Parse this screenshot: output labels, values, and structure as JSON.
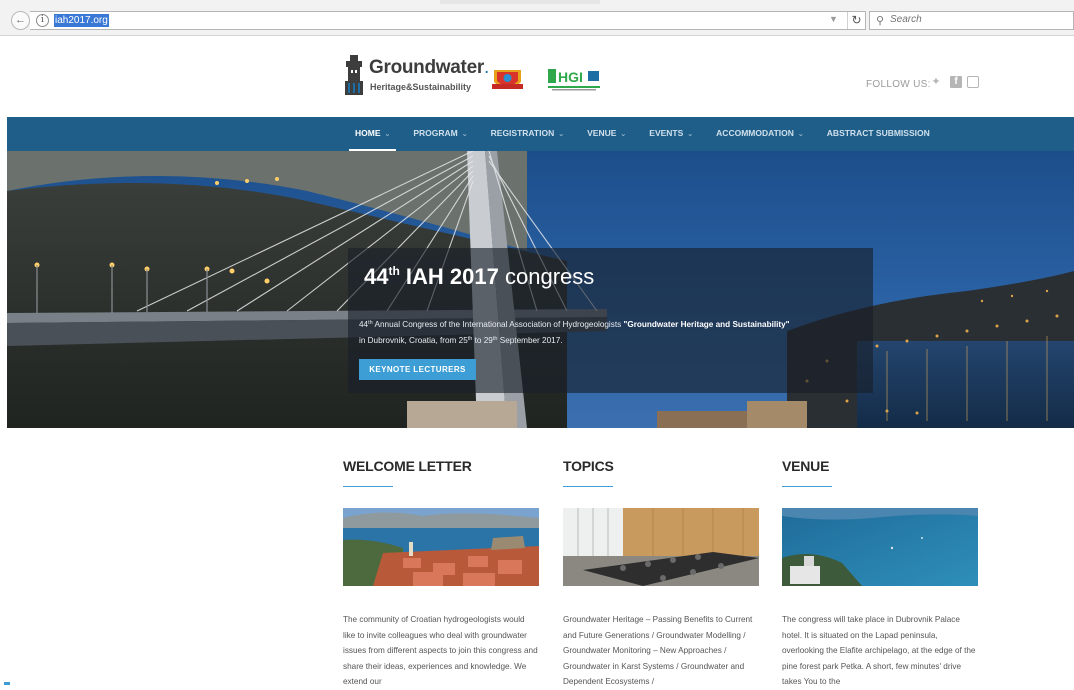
{
  "browser": {
    "url": "iah2017.org",
    "search_placeholder": "Search"
  },
  "header": {
    "logo_title_main": "Groundwater",
    "logo_title_accent": ".",
    "logo_subtitle": "Heritage&Sustainability",
    "partner_logo_text": "HGI",
    "follow_us": "FOLLOW US:"
  },
  "nav": {
    "items": [
      {
        "label": "HOME",
        "has_caret": true
      },
      {
        "label": "PROGRAM",
        "has_caret": true
      },
      {
        "label": "REGISTRATION",
        "has_caret": true
      },
      {
        "label": "VENUE",
        "has_caret": true
      },
      {
        "label": "EVENTS",
        "has_caret": true
      },
      {
        "label": "ACCOMMODATION",
        "has_caret": true
      },
      {
        "label": "ABSTRACT SUBMISSION",
        "has_caret": false
      }
    ],
    "caret": "⌄"
  },
  "hero": {
    "title_ordinal": "44",
    "title_sup": "th",
    "title_bold": " IAH 2017",
    "title_rest": " congress",
    "line1_pre": "44",
    "line1_sup": "th",
    "line1_mid": " Annual Congress of the International Association of Hydrogeologists ",
    "line1_bold": "\"Groundwater Heritage and Sustainability\"",
    "line2_pre": "in Dubrovnik, Croatia, from 25",
    "line2_sup1": "th",
    "line2_mid": " to 29",
    "line2_sup2": "th",
    "line2_end": " September 2017.",
    "button": "KEYNOTE LECTURERS"
  },
  "columns": [
    {
      "heading": "WELCOME LETTER",
      "text": "The community of Croatian hydrogeologists would like to invite colleagues who deal with groundwater issues from different aspects to join this congress and share their ideas, experiences and knowledge. We extend our"
    },
    {
      "heading": "TOPICS",
      "text": "Groundwater Heritage – Passing Benefits to Current and Future Generations / Groundwater Modelling / Groundwater Monitoring – New Approaches / Groundwater in Karst Systems / Groundwater and Dependent Ecosystems /"
    },
    {
      "heading": "VENUE",
      "text": "The congress will take place in Dubrovnik Palace hotel. It is situated on the Lapad peninsula, overlooking the Elafite archipelago, at the edge of the pine forest park Petka. A short, few minutes' drive takes You to the"
    }
  ],
  "colors": {
    "nav_bg": "#1f5e88",
    "accent": "#3d9ed6"
  }
}
